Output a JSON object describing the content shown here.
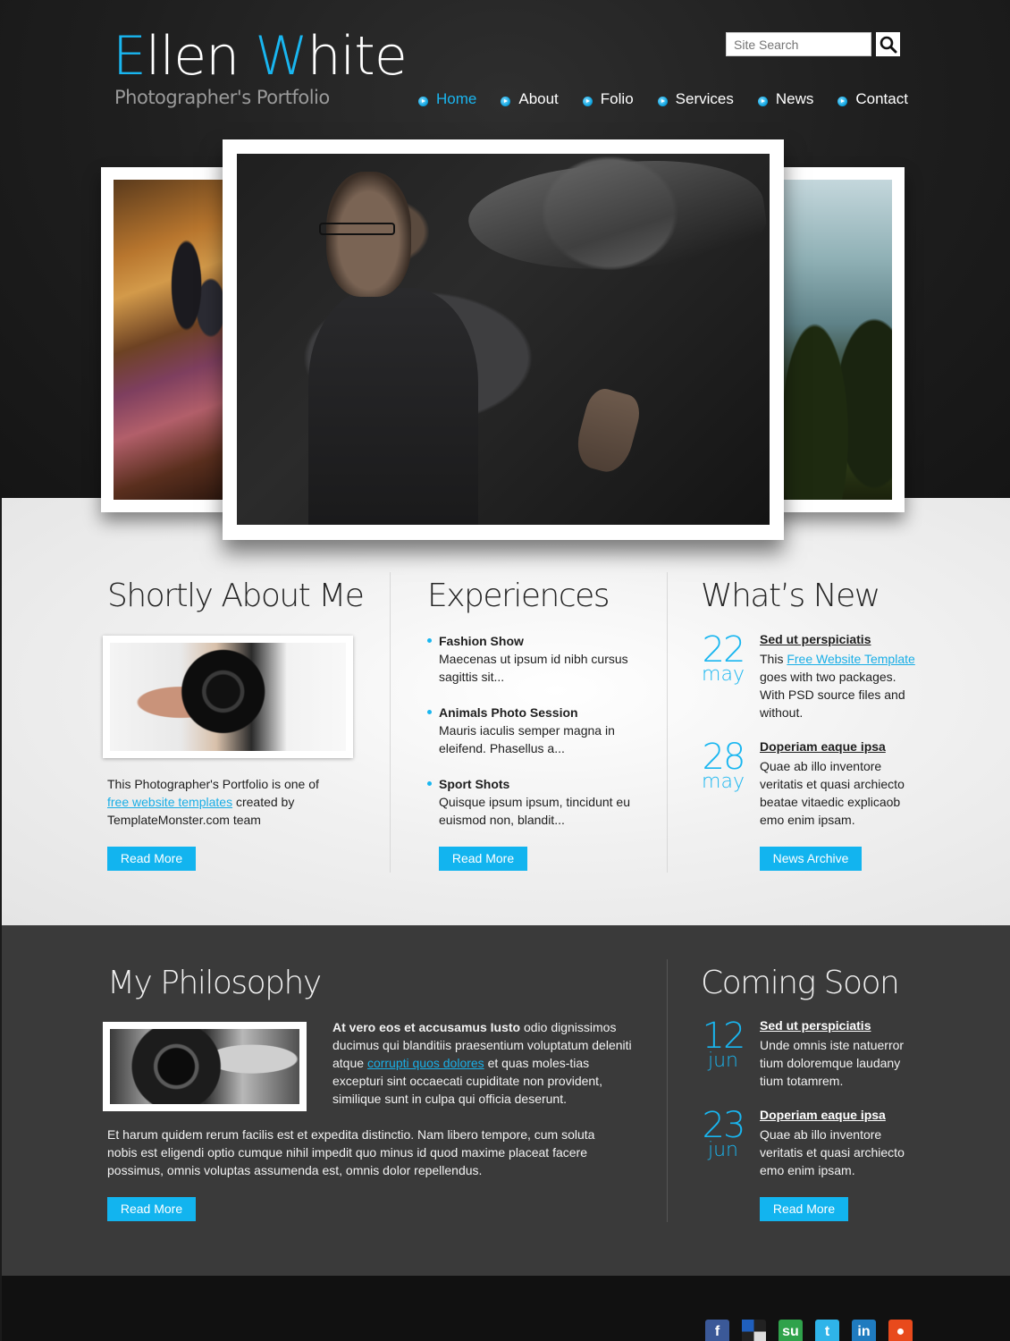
{
  "header": {
    "logo_first": "Ellen ",
    "logo_accent_w": "W",
    "logo_rest": "hite",
    "tagline": "Photographer's Portfolio",
    "search_placeholder": "Site Search",
    "nav": [
      {
        "label": "Home",
        "active": true
      },
      {
        "label": "About",
        "active": false
      },
      {
        "label": "Folio",
        "active": false
      },
      {
        "label": "Services",
        "active": false
      },
      {
        "label": "News",
        "active": false
      },
      {
        "label": "Contact",
        "active": false
      }
    ]
  },
  "about": {
    "heading": "Shortly About Me",
    "text_before": "This Photographer's Portfolio is one of ",
    "link": "free website templates",
    "text_after": " created by TemplateMonster.com team",
    "button": "Read More"
  },
  "experiences": {
    "heading": "Experiences",
    "items": [
      {
        "title": "Fashion Show",
        "desc": "Maecenas ut ipsum id nibh cursus sagittis sit..."
      },
      {
        "title": "Animals Photo Session",
        "desc": "Mauris iaculis semper magna in eleifend. Phasellus a..."
      },
      {
        "title": "Sport Shots",
        "desc": "Quisque ipsum ipsum, tincidunt eu euismod non, blandit..."
      }
    ],
    "button": "Read More"
  },
  "whats_new": {
    "heading": "What’s New",
    "items": [
      {
        "day": "22",
        "month": "may",
        "title": "Sed ut perspiciatis",
        "text_before": "This ",
        "link": "Free Website Template",
        "text_after": " goes with two packages. With PSD source files and without."
      },
      {
        "day": "28",
        "month": "may",
        "title": "Doperiam eaque ipsa ",
        "body": "Quae ab illo inventore veritatis et quasi archiecto beatae vitaedic explicaob emo enim ipsam."
      }
    ],
    "button": "News Archive"
  },
  "philosophy": {
    "heading": "My Philosophy",
    "bold_lead": "At vero eos et accusamus Iusto",
    "text_1": " odio dignissimos ducimus qui blanditiis praesentium voluptatum deleniti atque ",
    "link": "corrupti quos dolores",
    "text_2": " et quas moles-tias excepturi sint occaecati cupiditate non provident, similique sunt in culpa qui officia deserunt.",
    "paragraph": "Et harum quidem rerum facilis est et expedita distinctio. Nam libero tempore, cum soluta nobis est eligendi optio cumque nihil impedit quo minus id quod maxime placeat facere possimus, omnis voluptas assumenda est, omnis dolor repellendus.",
    "button": "Read More"
  },
  "coming_soon": {
    "heading": "Coming Soon",
    "items": [
      {
        "day": "12",
        "month": "jun",
        "title": "Sed ut perspiciatis",
        "body": "Unde omnis iste natuerror tium doloremque laudany tium totamrem."
      },
      {
        "day": "23",
        "month": "jun",
        "title": "Doperiam eaque ipsa ",
        "body": "Quae ab illo inventore veritatis et quasi archiecto emo enim ipsam."
      }
    ],
    "button": "Read More"
  },
  "social": [
    {
      "icon": "facebook-icon",
      "glyph": "f",
      "color": "#3b5998"
    },
    {
      "icon": "delicious-icon",
      "glyph": "",
      "color": "#ffffff"
    },
    {
      "icon": "stumbleupon-icon",
      "glyph": "su",
      "color": "#2fa24b"
    },
    {
      "icon": "twitter-icon",
      "glyph": "t",
      "color": "#2fb4e9"
    },
    {
      "icon": "linkedin-icon",
      "glyph": "in",
      "color": "#1f7bbf"
    },
    {
      "icon": "reddit-icon",
      "glyph": "●",
      "color": "#e84a1c"
    }
  ],
  "colors": {
    "accent": "#19b6f0",
    "button": "#12b4ef"
  }
}
